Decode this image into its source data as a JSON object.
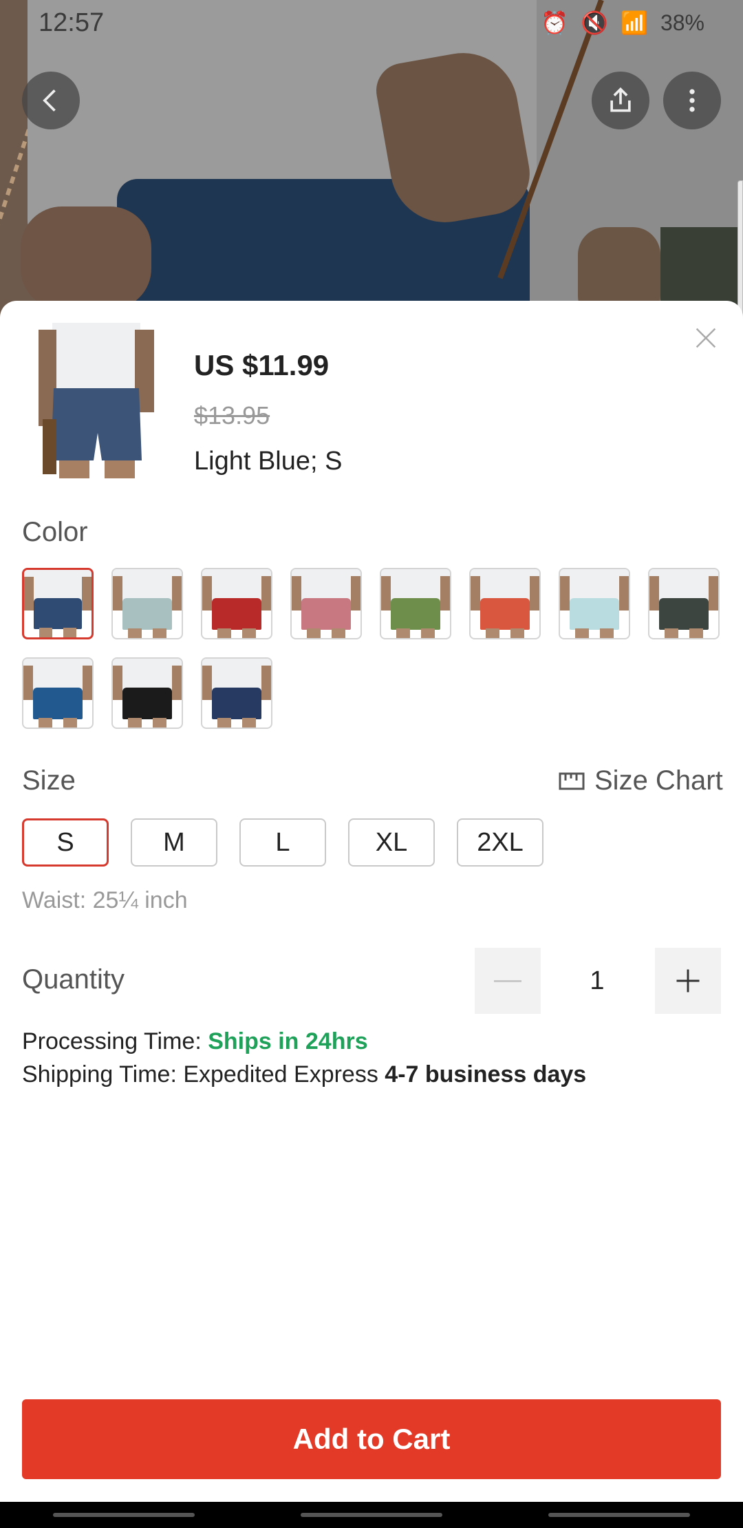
{
  "status_bar": {
    "time": "12:57",
    "battery": "38%"
  },
  "top_actions": {
    "back_icon": "chevron-left-icon",
    "share_icon": "share-icon",
    "more_icon": "more-vertical-icon"
  },
  "product": {
    "price": "US $11.99",
    "original_price": "$13.95",
    "selected_variant": "Light Blue; S"
  },
  "color": {
    "label": "Color",
    "swatches": [
      {
        "name": "Navy",
        "hex": "#2f4a73",
        "selected": true
      },
      {
        "name": "Light Gray",
        "hex": "#a8c0c0",
        "selected": false
      },
      {
        "name": "Red",
        "hex": "#b82a2a",
        "selected": false
      },
      {
        "name": "Pink",
        "hex": "#c87880",
        "selected": false
      },
      {
        "name": "Green",
        "hex": "#6e8e4c",
        "selected": false
      },
      {
        "name": "Orange Red",
        "hex": "#d8573e",
        "selected": false
      },
      {
        "name": "Light Blue",
        "hex": "#b9dce0",
        "selected": false
      },
      {
        "name": "Dark Gray",
        "hex": "#3d4540",
        "selected": false
      },
      {
        "name": "Blue",
        "hex": "#225a90",
        "selected": false
      },
      {
        "name": "Black",
        "hex": "#1b1b1b",
        "selected": false
      },
      {
        "name": "Navy 2",
        "hex": "#263a62",
        "selected": false
      }
    ]
  },
  "size": {
    "label": "Size",
    "chart_label": "Size Chart",
    "options": [
      "S",
      "M",
      "L",
      "XL",
      "2XL"
    ],
    "selected": "S",
    "waist_note": "Waist: 25¼ inch"
  },
  "quantity": {
    "label": "Quantity",
    "value": "1"
  },
  "shipping": {
    "processing_prefix": "Processing Time: ",
    "processing_value": "Ships in 24hrs",
    "shipping_prefix": "Shipping Time: Expedited Express ",
    "shipping_value": "4-7 business days"
  },
  "cta": {
    "add_to_cart": "Add to Cart"
  },
  "colors": {
    "accent": "#e23a27",
    "selected_border": "#d63a2f",
    "success": "#1fa15a"
  }
}
